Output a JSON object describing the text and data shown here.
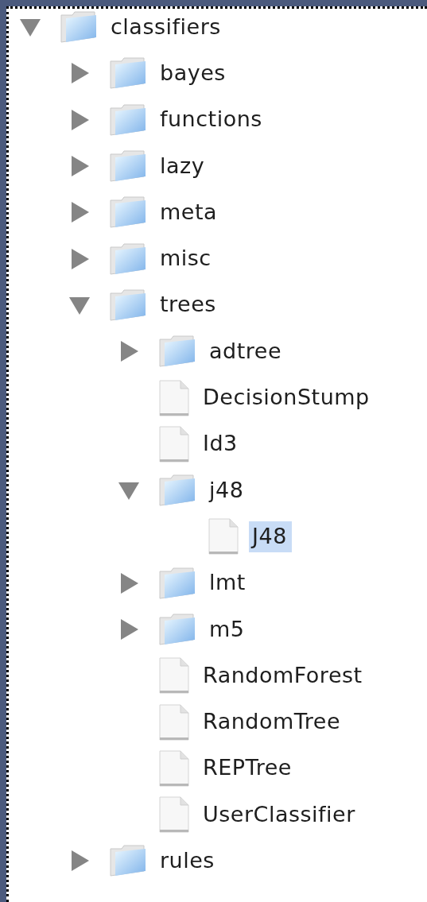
{
  "tree": {
    "items": [
      {
        "kind": "folder",
        "label": "classifiers",
        "expanded": true,
        "selected": false,
        "children": [
          {
            "kind": "folder",
            "label": "bayes",
            "expanded": false,
            "selected": false
          },
          {
            "kind": "folder",
            "label": "functions",
            "expanded": false,
            "selected": false
          },
          {
            "kind": "folder",
            "label": "lazy",
            "expanded": false,
            "selected": false
          },
          {
            "kind": "folder",
            "label": "meta",
            "expanded": false,
            "selected": false
          },
          {
            "kind": "folder",
            "label": "misc",
            "expanded": false,
            "selected": false
          },
          {
            "kind": "folder",
            "label": "trees",
            "expanded": true,
            "selected": false,
            "children": [
              {
                "kind": "folder",
                "label": "adtree",
                "expanded": false,
                "selected": false
              },
              {
                "kind": "file",
                "label": "DecisionStump",
                "selected": false
              },
              {
                "kind": "file",
                "label": "Id3",
                "selected": false
              },
              {
                "kind": "folder",
                "label": "j48",
                "expanded": true,
                "selected": false,
                "children": [
                  {
                    "kind": "file",
                    "label": "J48",
                    "selected": true
                  }
                ]
              },
              {
                "kind": "folder",
                "label": "lmt",
                "expanded": false,
                "selected": false
              },
              {
                "kind": "folder",
                "label": "m5",
                "expanded": false,
                "selected": false
              },
              {
                "kind": "file",
                "label": "RandomForest",
                "selected": false
              },
              {
                "kind": "file",
                "label": "RandomTree",
                "selected": false
              },
              {
                "kind": "file",
                "label": "REPTree",
                "selected": false
              },
              {
                "kind": "file",
                "label": "UserClassifier",
                "selected": false
              }
            ]
          },
          {
            "kind": "folder",
            "label": "rules",
            "expanded": false,
            "selected": false
          }
        ]
      }
    ]
  }
}
